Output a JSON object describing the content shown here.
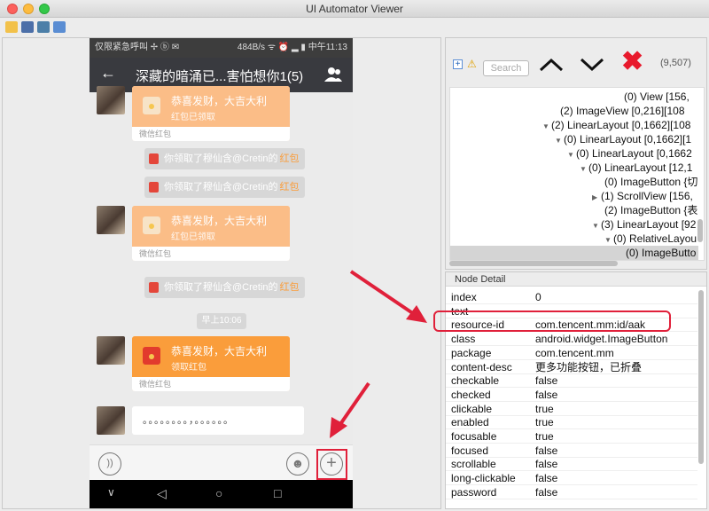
{
  "window": {
    "title": "UI Automator Viewer"
  },
  "phone": {
    "status_left": "仅限紧急呼叫 ✢ ⓑ ✉",
    "status_right": "484B/s ᯤ ⏰ ▂ ▮ 中午11:13",
    "chat_title": "深藏的暗涌已...害怕想你1(5)",
    "messages": {
      "rp1_title": "恭喜发财，大吉大利",
      "rp1_sub": "红包已领取",
      "rp1_foot": "微信红包",
      "sys1": "你领取了穆仙含@Cretin的",
      "sys_tag": "红包",
      "sys2": "你领取了穆仙含@Cretin的",
      "rp2_title": "恭喜发财，大吉大利",
      "rp2_sub": "红包已领取",
      "rp2_foot": "微信红包",
      "sys3": "你领取了穆仙含@Cretin的",
      "time": "早上10:06",
      "rp3_title": "恭喜发财，大吉大利",
      "rp3_sub": "领取红包",
      "rp3_foot": "微信红包",
      "text_bubble": "。。。。。。。。，。。。。。。"
    }
  },
  "toolbar": {
    "search_placeholder": "Search",
    "coords": "(9,507)"
  },
  "tree": {
    "rows": [
      "(0) View [156,",
      "(2) ImageView [0,216][108",
      "(2) LinearLayout [0,1662][108",
      "(0) LinearLayout [0,1662][1",
      "(0) LinearLayout [0,1662",
      "(0) LinearLayout [12,1",
      "(0) ImageButton {切",
      "(1) ScrollView [156,",
      "(2) ImageButton {表",
      "(3) LinearLayout [92",
      "(0) RelativeLayou",
      "(0) ImageButto"
    ]
  },
  "node_detail": {
    "title": "Node Detail",
    "props": [
      {
        "key": "index",
        "value": "0"
      },
      {
        "key": "text",
        "value": ""
      },
      {
        "key": "resource-id",
        "value": "com.tencent.mm:id/aak"
      },
      {
        "key": "class",
        "value": "android.widget.ImageButton"
      },
      {
        "key": "package",
        "value": "com.tencent.mm"
      },
      {
        "key": "content-desc",
        "value": "更多功能按钮，已折叠"
      },
      {
        "key": "checkable",
        "value": "false"
      },
      {
        "key": "checked",
        "value": "false"
      },
      {
        "key": "clickable",
        "value": "true"
      },
      {
        "key": "enabled",
        "value": "true"
      },
      {
        "key": "focusable",
        "value": "true"
      },
      {
        "key": "focused",
        "value": "false"
      },
      {
        "key": "scrollable",
        "value": "false"
      },
      {
        "key": "long-clickable",
        "value": "false"
      },
      {
        "key": "password",
        "value": "false"
      }
    ]
  },
  "colors": {
    "highlight": "#e0203a",
    "redpacket_open": "#fa9d3b",
    "redpacket_taken": "#fbbd87",
    "chat_header": "#393a3f"
  },
  "icons": {
    "expand": "plus-square-icon",
    "warning": "warning-icon",
    "up": "chevron-up-icon",
    "down": "chevron-down-icon",
    "delete": "red-x-icon"
  }
}
